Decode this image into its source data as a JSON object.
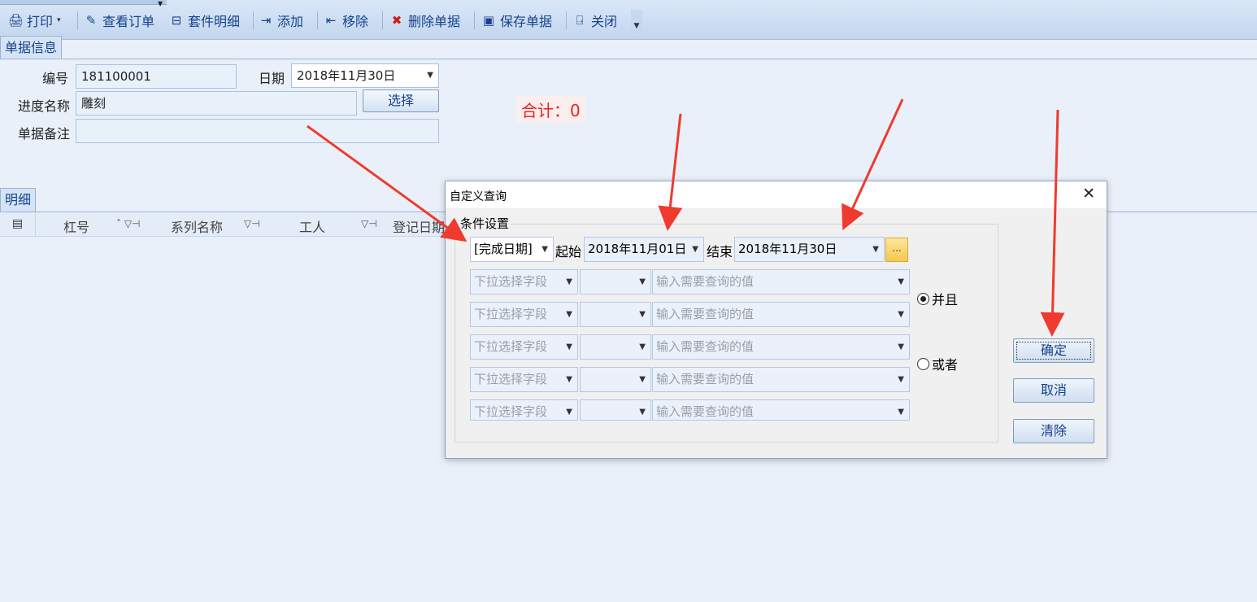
{
  "toolbar": {
    "items": [
      {
        "label": "打印",
        "icon": "printer-icon"
      },
      {
        "label": "查看订单",
        "icon": "view-order-icon"
      },
      {
        "label": "套件明细",
        "icon": "kit-detail-icon"
      },
      {
        "label": "添加",
        "icon": "add-icon"
      },
      {
        "label": "移除",
        "icon": "remove-icon"
      },
      {
        "label": "删除单据",
        "icon": "delete-icon"
      },
      {
        "label": "保存单据",
        "icon": "save-icon"
      },
      {
        "label": "关闭",
        "icon": "close-door-icon"
      }
    ]
  },
  "tabs": {
    "info": "单据信息",
    "detail": "明细"
  },
  "form": {
    "number_label": "编号",
    "number_value": "181100001",
    "date_label": "日期",
    "date_value": "2018年11月30日",
    "progress_label": "进度名称",
    "progress_value": "雕刻",
    "select_button": "选择",
    "remark_label": "单据备注",
    "remark_value": "",
    "total": "合计：0"
  },
  "grid": {
    "columns": [
      "杠号",
      "系列名称",
      "工人",
      "登记日期"
    ]
  },
  "dialog": {
    "title": "自定义查询",
    "group_title": "条件设置",
    "date_field": "[完成日期]",
    "start_label": "起始",
    "start_value": "2018年11月01日",
    "end_label": "结束",
    "end_value": "2018年11月30日",
    "ellipsis": "...",
    "field_placeholder": "下拉选择字段",
    "value_placeholder": "输入需要查询的值",
    "and_label": "并且",
    "or_label": "或者",
    "logic_selected": "并且",
    "ok_button": "确定",
    "cancel_button": "取消",
    "clear_button": "清除"
  },
  "colors": {
    "accent_text": "#15428b",
    "total_red": "#e8231a",
    "annotation_arrow": "#f03a2e"
  }
}
